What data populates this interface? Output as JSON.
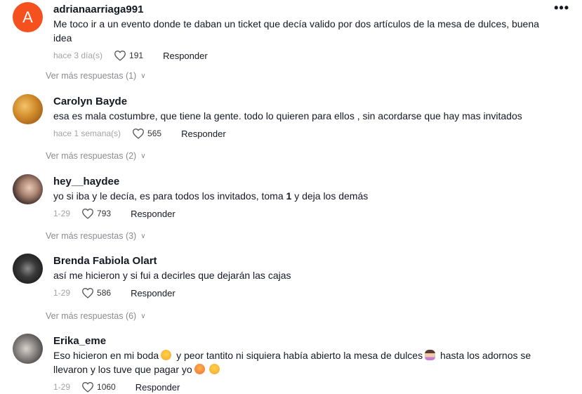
{
  "more_options": "•••",
  "comments": [
    {
      "avatar_letter": "A",
      "username": "adrianaarriaga991",
      "text": "Me toco ir a un evento donde te daban un ticket que decía valido por dos artículos de la mesa de dulces, buena idea",
      "date": "hace 3 día(s)",
      "likes": "191",
      "reply_label": "Responder",
      "more_replies": "Ver más respuestas (1)"
    },
    {
      "username": "Carolyn Bayde",
      "text": "esa es mala costumbre, que tiene la gente. todo lo quieren para ellos , sin acordarse que hay mas invitados",
      "date": "hace 1 semana(s)",
      "likes": "565",
      "reply_label": "Responder",
      "more_replies": "Ver más respuestas (2)"
    },
    {
      "username": "hey__haydee",
      "text_before": "yo si iba y le decía, es para todos los invitados, toma ",
      "text_bold": "1",
      "text_after": " y deja los demás",
      "date": "1-29",
      "likes": "793",
      "reply_label": "Responder",
      "more_replies": "Ver más respuestas (3)"
    },
    {
      "username": "Brenda Fabiola Olart",
      "text": "así me hicieron y si fui a decirles que dejarán las cajas",
      "date": "1-29",
      "likes": "586",
      "reply_label": "Responder",
      "more_replies": "Ver más respuestas (6)"
    },
    {
      "username": "Erika_eme",
      "text_part1": "Eso hicieron en mi boda",
      "text_part2": " y peor tantito ni siquiera había abierto la mesa de dulces",
      "text_part3": " hasta los adornos se llevaron y los tuve que pagar yo",
      "date": "1-29",
      "likes": "1060",
      "reply_label": "Responder"
    }
  ],
  "colors": {
    "avatar_letter_bg": "#f4511e",
    "text": "#161823",
    "muted": "#a2a3a8"
  }
}
